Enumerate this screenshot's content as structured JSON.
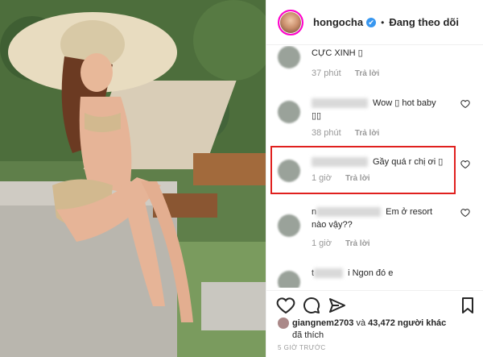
{
  "header": {
    "username": "hongocha",
    "verified_mark": "✔",
    "separator": "•",
    "follow_status": "Đang theo dõi"
  },
  "comments": [
    {
      "text": "CỰC XINH ▯",
      "time": "37 phút",
      "reply": "Trả lời"
    },
    {
      "text": "Wow ▯ hot baby",
      "text2": "▯▯",
      "time": "38 phút",
      "reply": "Trả lời"
    },
    {
      "text": "Gầy quá r chị ơi ▯",
      "time": "1 giờ",
      "reply": "Trả lời"
    },
    {
      "prefix": "n",
      "text": "Em ở resort",
      "text2": "nào vậy??",
      "time": "1 giờ",
      "reply": "Trả lời"
    },
    {
      "prefix": "t",
      "text": "i Ngon đó e"
    }
  ],
  "likes": {
    "first_user": "giangnem2703",
    "connector": "và",
    "count": "43,472 người khác",
    "suffix": "đã thích"
  },
  "post_time": "5 GIỜ TRƯỚC",
  "icons": [
    "heart-icon",
    "comment-icon",
    "share-icon",
    "bookmark-icon"
  ]
}
